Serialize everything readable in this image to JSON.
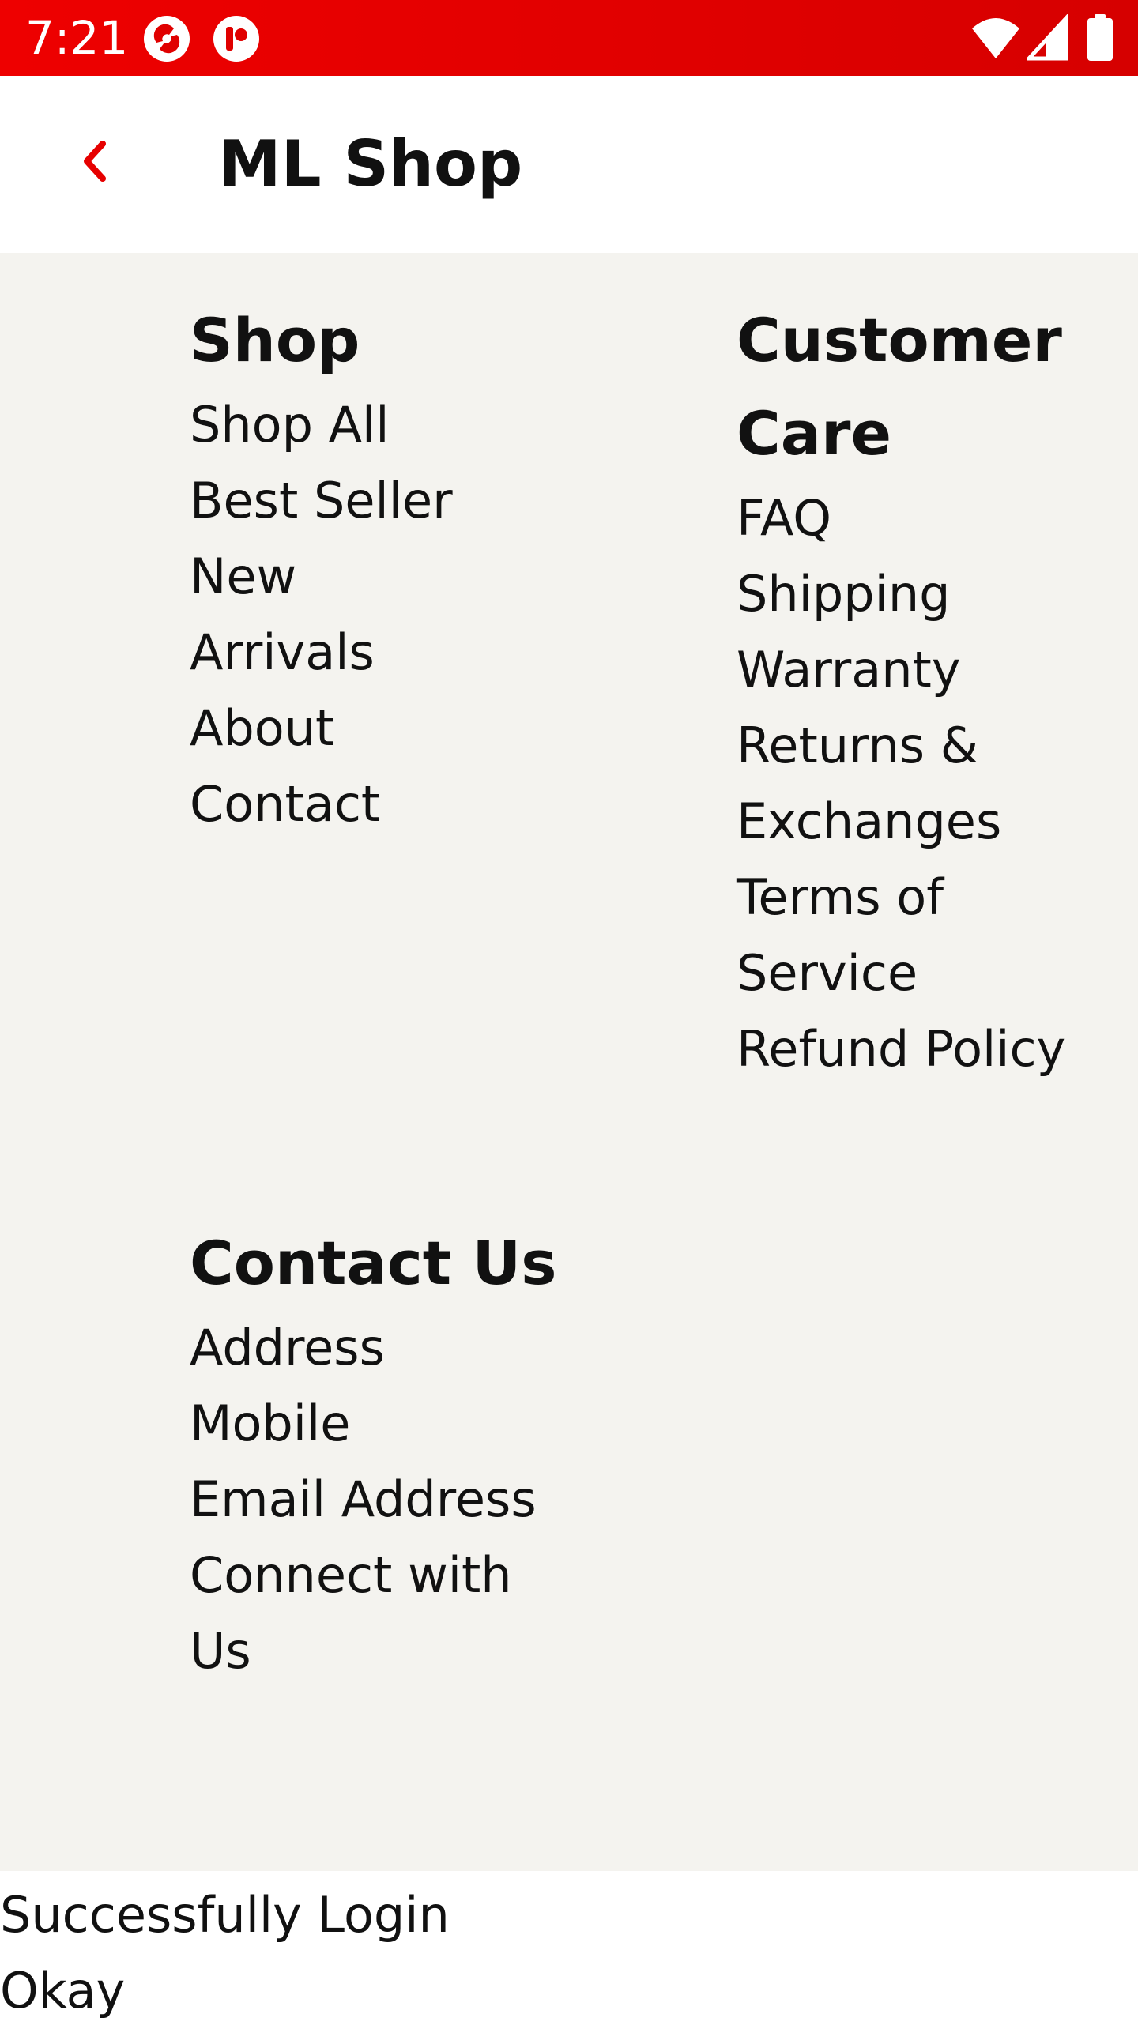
{
  "status_bar": {
    "time": "7:21",
    "icons": [
      "app-notification-icon",
      "app-notification-icon-2",
      "wifi-icon",
      "signal-icon",
      "battery-icon"
    ],
    "background": "#e60000"
  },
  "app_bar": {
    "title": "ML Shop",
    "back_icon": "chevron-left-icon",
    "accent": "#e60000"
  },
  "footer": {
    "background": "#f4f3ef",
    "shop": {
      "heading": "Shop",
      "items": [
        "Shop All",
        "Best Seller",
        "New\nArrivals",
        "About",
        "Contact"
      ]
    },
    "customer_care": {
      "heading": "Customer\nCare",
      "items": [
        "FAQ",
        "Shipping",
        "Warranty",
        "Returns &\nExchanges",
        "Terms of\nService",
        "Refund Policy"
      ]
    },
    "contact_us": {
      "heading": "Contact Us",
      "items": [
        "Address",
        "Mobile",
        "Email Address",
        "Connect with\nUs"
      ]
    }
  },
  "dialog": {
    "message": "Successfully Login",
    "ok_label": "Okay"
  }
}
